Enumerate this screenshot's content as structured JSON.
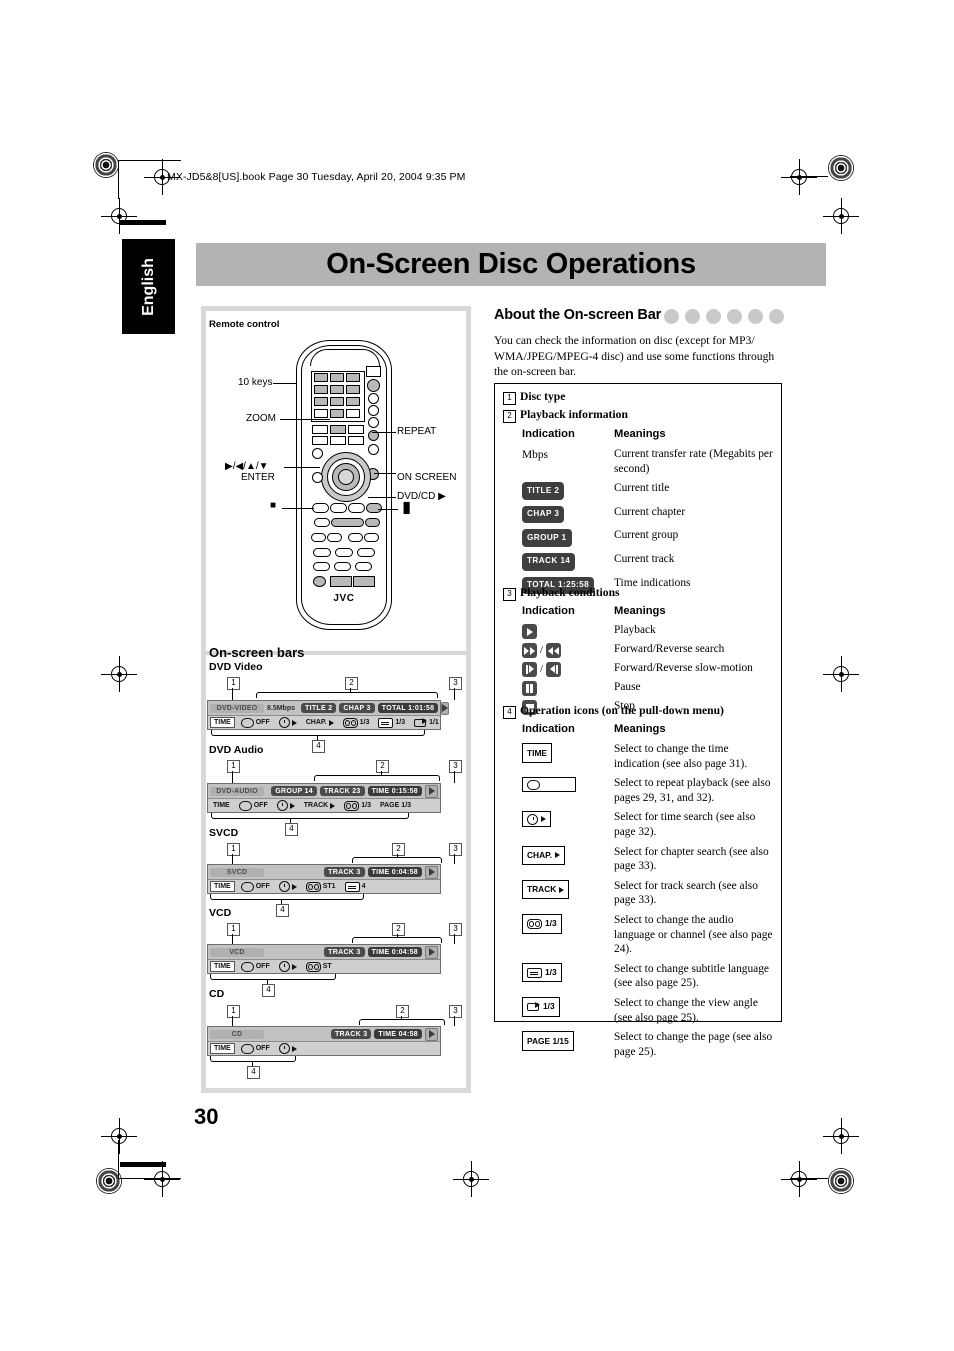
{
  "slug": "MX-JD5&8[US].book  Page 30  Tuesday, April 20, 2004  9:35 PM",
  "language_tab": "English",
  "page_title": "On-Screen Disc Operations",
  "page_number": "30",
  "remote": {
    "caption": "Remote control",
    "brand": "JVC",
    "callouts": {
      "ten_keys": "10 keys",
      "zoom": "ZOOM",
      "cursor": "▶/◀/▲/▼",
      "enter": "ENTER",
      "repeat": "REPEAT",
      "on_screen": "ON SCREEN",
      "dvd_cd": "DVD/CD ▶",
      "stop": "■",
      "pause": "▐▌"
    }
  },
  "onscreen_bars": {
    "heading": "On-screen bars",
    "bars": [
      {
        "label": "DVD Video",
        "disc": "DVD-VIDEO",
        "rate": "8.5Mbps",
        "info": [
          "TITLE  2",
          "CHAP  3",
          "TOTAL   1:01:58"
        ],
        "ops": [
          "TIME",
          "OFF",
          "",
          "CHAP.",
          "1/3",
          "1/3",
          "1/1"
        ],
        "op_labels": {
          "time": "TIME",
          "repeat": "OFF",
          "chapter": "CHAP.",
          "audio": "1/3",
          "subtitle": "1/3",
          "angle": "1/1"
        }
      },
      {
        "label": "DVD Audio",
        "disc": "DVD-AUDIO",
        "rate": "",
        "info": [
          "GROUP 14",
          "TRACK 23",
          "TIME    0:15:58"
        ],
        "op_labels": {
          "time": "TIME",
          "repeat": "OFF",
          "track": "TRACK",
          "audio": "1/3",
          "page": "PAGE",
          "page_val": "1/3"
        }
      },
      {
        "label": "SVCD",
        "disc": "SVCD",
        "rate": "",
        "info": [
          "TRACK  3",
          "TIME    0:04:58"
        ],
        "op_labels": {
          "time": "TIME",
          "repeat": "OFF",
          "audio": "ST1",
          "subtitle": "4"
        }
      },
      {
        "label": "VCD",
        "disc": "VCD",
        "rate": "",
        "info": [
          "TRACK  3",
          "TIME    0:04:58"
        ],
        "op_labels": {
          "time": "TIME",
          "repeat": "OFF",
          "audio": "ST"
        }
      },
      {
        "label": "CD",
        "disc": "CD",
        "rate": "",
        "info": [
          "TRACK  3",
          "TIME      04:58"
        ],
        "op_labels": {
          "time": "TIME",
          "repeat": "OFF"
        }
      }
    ],
    "markers": [
      "1",
      "2",
      "3",
      "4"
    ]
  },
  "about": {
    "heading": "About the On-screen Bar",
    "intro": "You can check the information on disc (except for MP3/ WMA/JPEG/MPEG-4 disc) and use some functions through the on-screen bar.",
    "sections": [
      {
        "num": "1",
        "title": "Disc type"
      },
      {
        "num": "2",
        "title": "Playback information",
        "col1": "Indication",
        "col2": "Meanings",
        "rows": [
          {
            "ind_type": "text",
            "ind": "Mbps",
            "mean": "Current transfer rate (Megabits per second)"
          },
          {
            "ind_type": "chip",
            "ind": "TITLE  2",
            "mean": "Current title"
          },
          {
            "ind_type": "chip",
            "ind": "CHAP  3",
            "mean": "Current chapter"
          },
          {
            "ind_type": "chip",
            "ind": "GROUP 1",
            "mean": "Current group"
          },
          {
            "ind_type": "chip",
            "ind": "TRACK 14",
            "mean": "Current track"
          },
          {
            "ind_type": "chip",
            "ind": "TOTAL 1:25:58",
            "mean": "Time indications"
          }
        ]
      },
      {
        "num": "3",
        "title": "Playback conditions",
        "col1": "Indication",
        "col2": "Meanings",
        "rows": [
          {
            "ind_type": "cond",
            "icon": "play",
            "mean": "Playback"
          },
          {
            "ind_type": "cond",
            "icon": "ff-rew",
            "mean": "Forward/Reverse search"
          },
          {
            "ind_type": "cond",
            "icon": "slow",
            "mean": "Forward/Reverse slow-motion"
          },
          {
            "ind_type": "cond",
            "icon": "pause",
            "mean": "Pause"
          },
          {
            "ind_type": "cond",
            "icon": "stop",
            "mean": "Stop"
          }
        ]
      },
      {
        "num": "4",
        "title": "Operation icons (on the pull-down menu)",
        "col1": "Indication",
        "col2": "Meanings",
        "rows": [
          {
            "ind_type": "box",
            "icon": "time",
            "ind": "TIME",
            "mean": "Select to change the time indication (see also page 31)."
          },
          {
            "ind_type": "box",
            "icon": "repeat",
            "ind": "",
            "mean": "Select to repeat playback (see also pages 29, 31, and 32)."
          },
          {
            "ind_type": "box",
            "icon": "timesearch",
            "ind": "",
            "mean": "Select for time search (see also page 32)."
          },
          {
            "ind_type": "box",
            "icon": "chapsearch",
            "ind": "CHAP.",
            "mean": "Select for chapter search (see also page 33)."
          },
          {
            "ind_type": "box",
            "icon": "tracksearch",
            "ind": "TRACK",
            "mean": "Select for track search (see also page 33)."
          },
          {
            "ind_type": "box",
            "icon": "audio",
            "ind": "1/3",
            "mean": "Select to change the audio language or channel (see also page 24)."
          },
          {
            "ind_type": "box",
            "icon": "subtitle",
            "ind": "1/3",
            "mean": "Select to change subtitle language (see also page 25)."
          },
          {
            "ind_type": "box",
            "icon": "angle",
            "ind": "1/3",
            "mean": "Select to change the view angle (see also page 25)."
          },
          {
            "ind_type": "box",
            "icon": "page",
            "ind": "PAGE 1/15",
            "mean": "Select to change the page (see also page 25)."
          }
        ]
      }
    ]
  },
  "colors": {
    "title_bar": "#b3b3b3",
    "panel": "#d9d9d9",
    "chip_dark": "#3f3f3f",
    "dots": "#c9c9c9"
  }
}
